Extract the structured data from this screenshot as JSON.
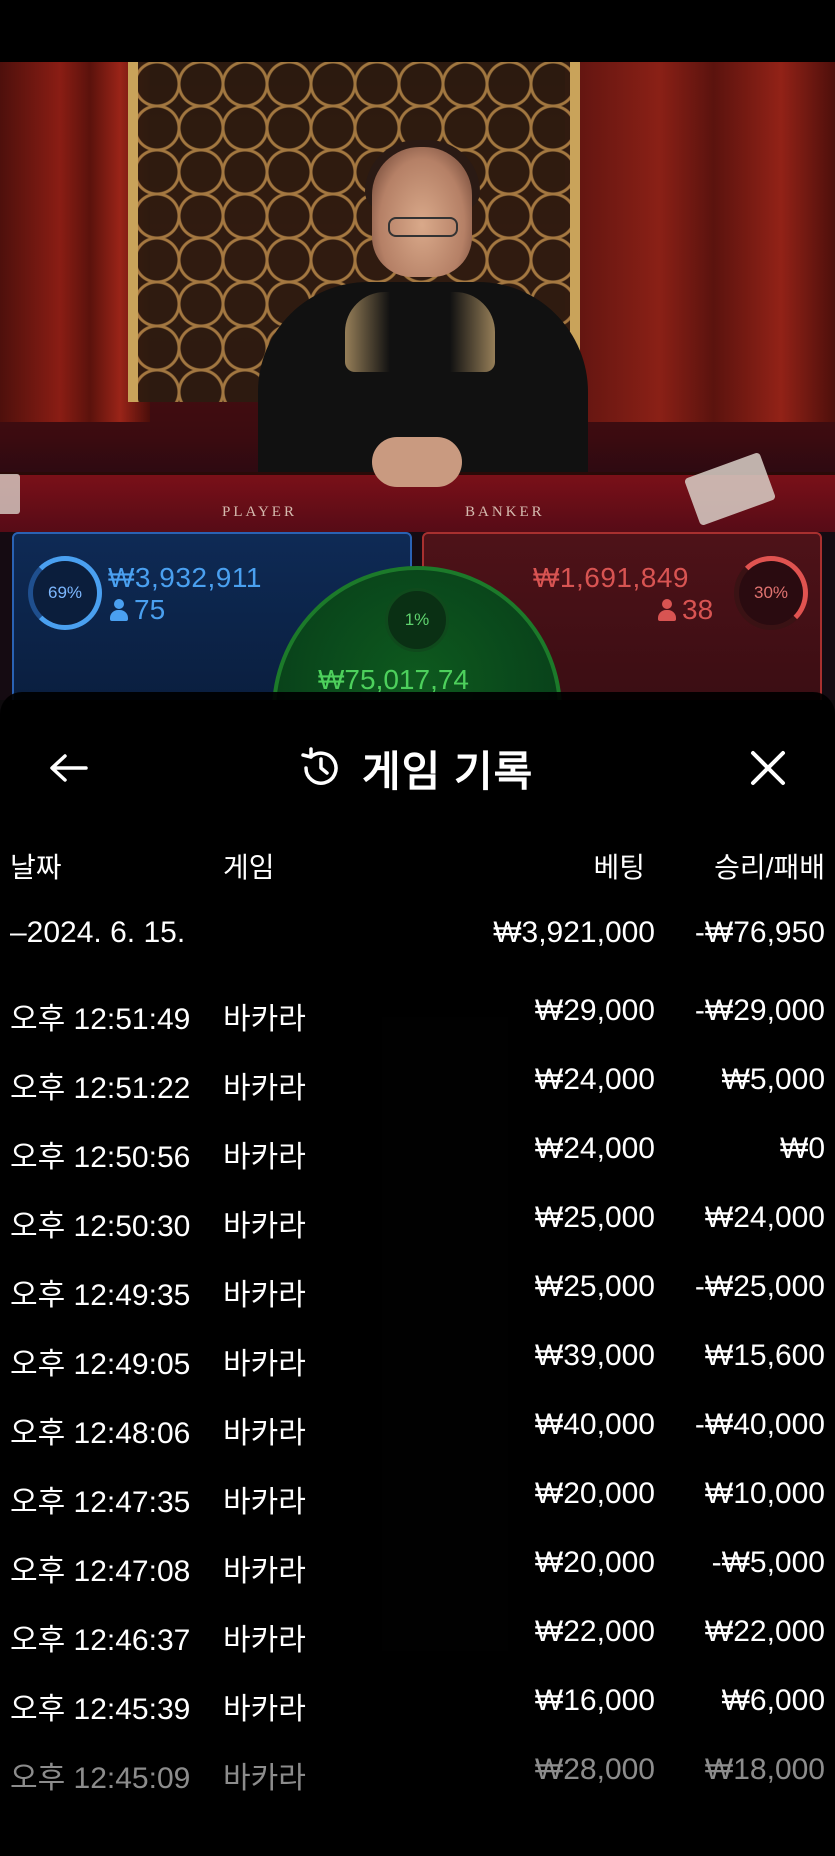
{
  "board": {
    "player": {
      "percent": "69%",
      "amount": "₩3,932,911",
      "count": "75"
    },
    "banker": {
      "percent": "30%",
      "amount": "₩1,691,849",
      "count": "38"
    },
    "tie": {
      "percent": "1%",
      "amount": "₩75,017,74"
    }
  },
  "table_labels": {
    "player": "PLAYER",
    "banker": "BANKER"
  },
  "modal": {
    "title": "게임 기록",
    "columns": {
      "date": "날짜",
      "game": "게임",
      "bet": "베팅",
      "result": "승리/패배"
    },
    "summary": {
      "date": "–2024. 6. 15.",
      "bet": "₩3,921,000",
      "result": "-₩76,950"
    },
    "rows": [
      {
        "time": "오후 12:51:49",
        "game": "바카라",
        "bet": "₩29,000",
        "result": "-₩29,000"
      },
      {
        "time": "오후 12:51:22",
        "game": "바카라",
        "bet": "₩24,000",
        "result": "₩5,000"
      },
      {
        "time": "오후 12:50:56",
        "game": "바카라",
        "bet": "₩24,000",
        "result": "₩0"
      },
      {
        "time": "오후 12:50:30",
        "game": "바카라",
        "bet": "₩25,000",
        "result": "₩24,000"
      },
      {
        "time": "오후 12:49:35",
        "game": "바카라",
        "bet": "₩25,000",
        "result": "-₩25,000"
      },
      {
        "time": "오후 12:49:05",
        "game": "바카라",
        "bet": "₩39,000",
        "result": "₩15,600"
      },
      {
        "time": "오후 12:48:06",
        "game": "바카라",
        "bet": "₩40,000",
        "result": "-₩40,000"
      },
      {
        "time": "오후 12:47:35",
        "game": "바카라",
        "bet": "₩20,000",
        "result": "₩10,000"
      },
      {
        "time": "오후 12:47:08",
        "game": "바카라",
        "bet": "₩20,000",
        "result": "-₩5,000"
      },
      {
        "time": "오후 12:46:37",
        "game": "바카라",
        "bet": "₩22,000",
        "result": "₩22,000"
      },
      {
        "time": "오후 12:45:39",
        "game": "바카라",
        "bet": "₩16,000",
        "result": "₩6,000"
      },
      {
        "time": "오후 12:45:09",
        "game": "바카라",
        "bet": "₩28,000",
        "result": "₩18,000"
      }
    ]
  },
  "icons": {
    "back": "arrow-left-icon",
    "history": "history-icon",
    "close": "close-icon",
    "person": "person-icon"
  },
  "colors": {
    "player": "#4aa0f0",
    "banker": "#e05350",
    "tie": "#4dd05c"
  }
}
